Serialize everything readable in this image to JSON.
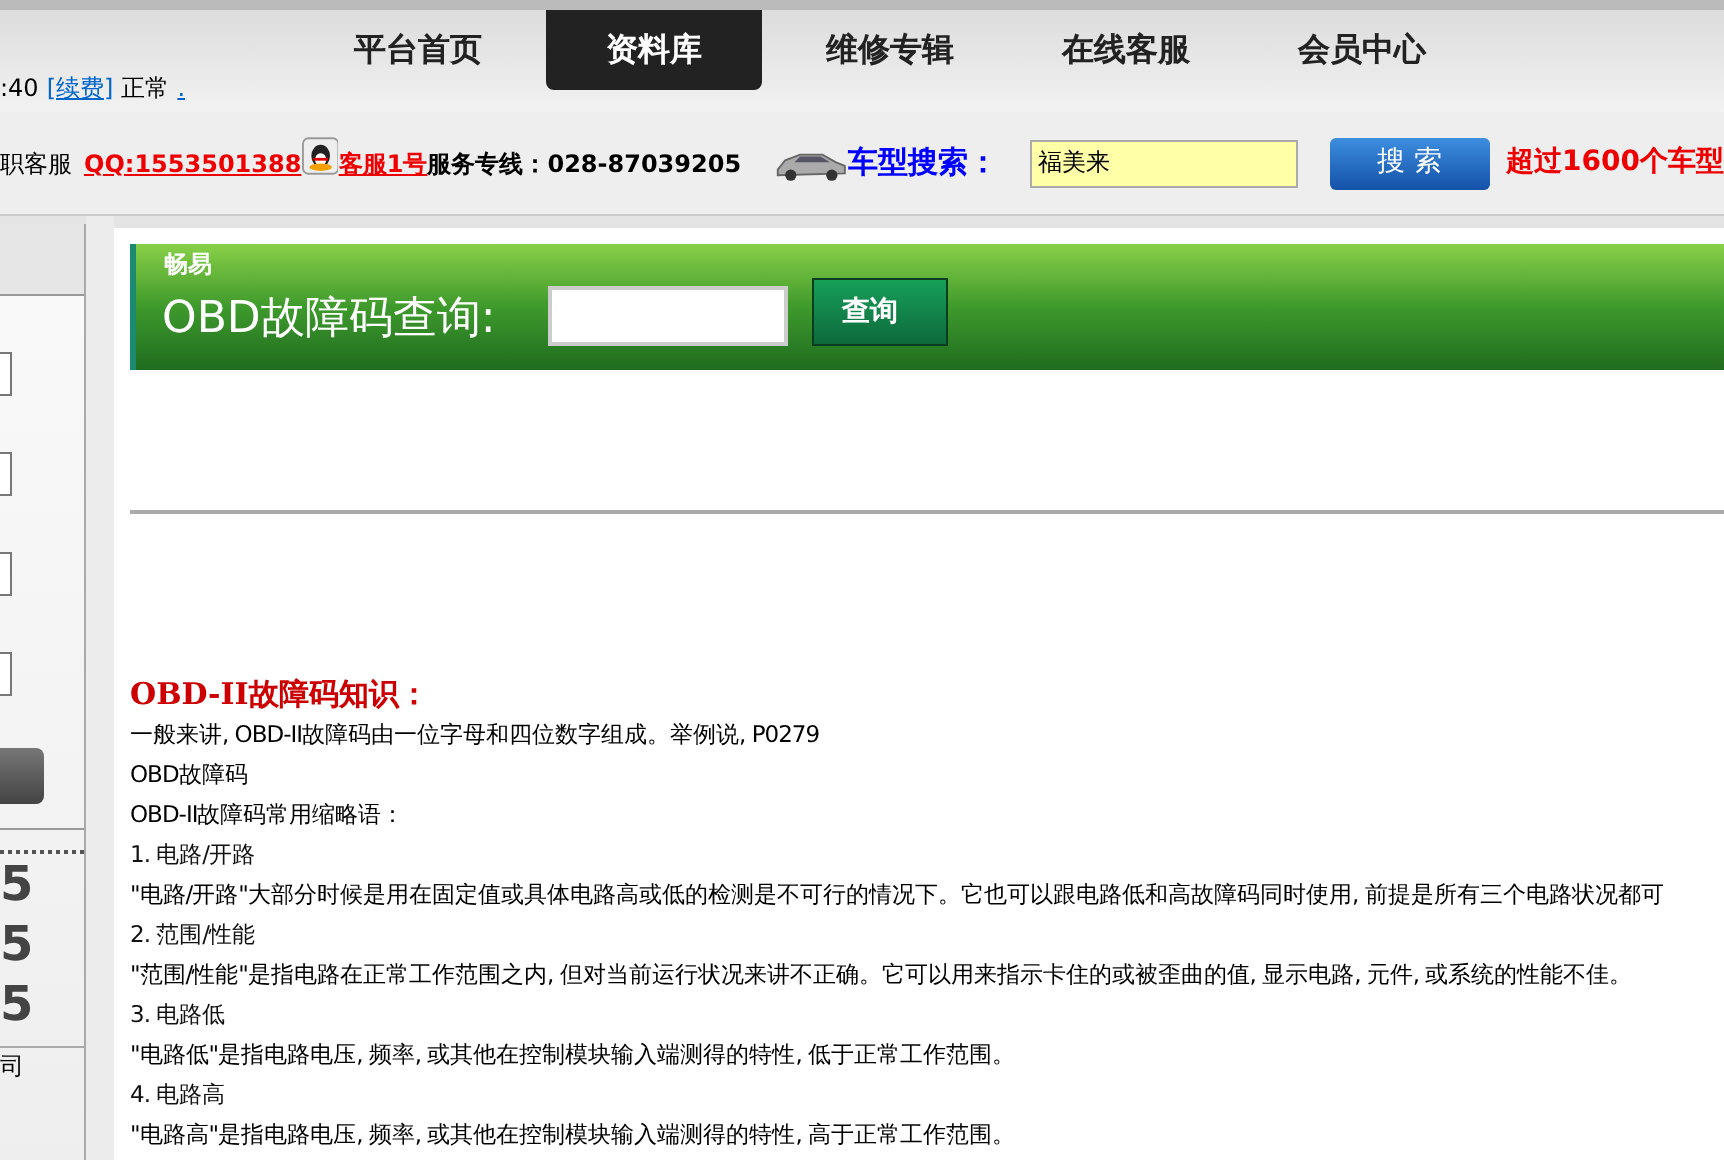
{
  "nav": {
    "tabs": [
      {
        "label": "平台首页",
        "selected": false
      },
      {
        "label": "资料库",
        "selected": true
      },
      {
        "label": "维修专辑",
        "selected": false
      },
      {
        "label": "在线客服",
        "selected": false
      },
      {
        "label": "会员中心",
        "selected": false
      }
    ]
  },
  "account_bar": {
    "time": ":40",
    "renew_link": "[续费]",
    "status": "正常",
    "extra_link": "."
  },
  "contact_bar": {
    "service_label": "职客服",
    "qq_link": "QQ:1553501388",
    "agent_link": "客服1号",
    "hotline": "服务专线：028-87039205",
    "search_label": "车型搜索：",
    "search_value": "福美来",
    "search_button": "搜 索",
    "promo": "超过1600个车型"
  },
  "sidebar": {
    "digits": [
      "5",
      "5",
      "5"
    ],
    "footer": "司"
  },
  "obd_search": {
    "brand": "畅易",
    "title": "OBD故障码查询:",
    "button": "查询"
  },
  "article": {
    "title": "OBD-II故障码知识：",
    "lines": [
      {
        "kind": "body",
        "text": "一般来讲, OBD-II故障码由一位字母和四位数字组成。举例说, P0279"
      },
      {
        "kind": "body",
        "text": "OBD故障码"
      },
      {
        "kind": "body",
        "text": "OBD-II故障码常用缩略语："
      },
      {
        "kind": "heading",
        "text": "1. 电路/开路"
      },
      {
        "kind": "body",
        "text": "\"电路/开路\"大部分时候是用在固定值或具体电路高或低的检测是不可行的情况下。它也可以跟电路低和高故障码同时使用, 前提是所有三个电路状况都可"
      },
      {
        "kind": "heading",
        "text": "2. 范围/性能"
      },
      {
        "kind": "body",
        "text": "\"范围/性能\"是指电路在正常工作范围之内, 但对当前运行状况来讲不正确。它可以用来指示卡住的或被歪曲的值, 显示电路, 元件, 或系统的性能不佳。"
      },
      {
        "kind": "heading",
        "text": "3. 电路低"
      },
      {
        "kind": "body",
        "text": "\"电路低\"是指电路电压, 频率, 或其他在控制模块输入端测得的特性, 低于正常工作范围。"
      },
      {
        "kind": "heading",
        "text": "4. 电路高"
      },
      {
        "kind": "body",
        "text": "\"电路高\"是指电路电压, 频率, 或其他在控制模块输入端测得的特性, 高于正常工作范围。"
      }
    ]
  }
}
